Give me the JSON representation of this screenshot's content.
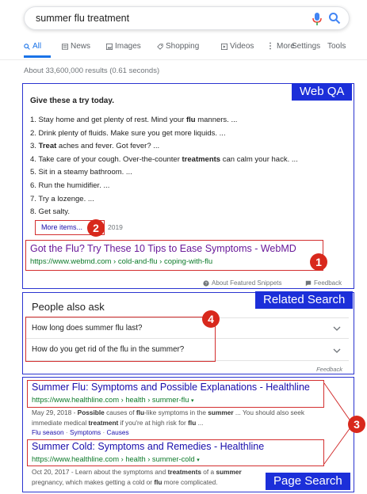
{
  "search": {
    "query": "summer flu treatment"
  },
  "tabs": [
    {
      "icon": "search-icon",
      "label": "All"
    },
    {
      "icon": "news-icon",
      "label": "News"
    },
    {
      "icon": "images-icon",
      "label": "Images"
    },
    {
      "icon": "shopping-icon",
      "label": "Shopping"
    },
    {
      "icon": "videos-icon",
      "label": "Videos"
    },
    {
      "icon": "more-icon",
      "label": "More"
    }
  ],
  "tools": {
    "settings": "Settings",
    "tools": "Tools"
  },
  "result_stats": "About 33,600,000 results (0.61 seconds)",
  "snippet": {
    "heading": "Give these a try today.",
    "items": [
      [
        "1. Stay home and get plenty of rest. Mind your ",
        "flu",
        " manners. ..."
      ],
      [
        "2. Drink plenty of fluids. Make sure you get more liquids. ...",
        "",
        ""
      ],
      [
        "3. ",
        "Treat",
        " aches and fever. Got fever? ..."
      ],
      [
        "4. Take care of your cough. Over-the-counter ",
        "treatments",
        " can calm your hack. ..."
      ],
      [
        "5. Sit in a steamy bathroom. ...",
        "",
        ""
      ],
      [
        "6. Run the humidifier. ...",
        "",
        ""
      ],
      [
        "7. Try a lozenge. ...",
        "",
        ""
      ],
      [
        "8. Get salty.",
        "",
        ""
      ]
    ],
    "more_items": "More items...",
    "date": "2019",
    "title": "Got the Flu? Try These 10 Tips to Ease Symptoms - WebMD",
    "url": "https://www.webmd.com › cold-and-flu › coping-with-flu",
    "about_link": "About Featured Snippets",
    "feedback": "Feedback"
  },
  "people_also_ask": {
    "title": "People also ask",
    "questions": [
      "How long does summer flu last?",
      "How do you get rid of the flu in the summer?"
    ],
    "feedback": "Feedback"
  },
  "results": [
    {
      "title": "Summer Flu: Symptoms and Possible Explanations - Healthline",
      "url": "https://www.healthline.com › health › summer-flu",
      "snippet_line1": [
        "May 29, 2018 - ",
        "Possible",
        " causes of ",
        "flu",
        "-like symptoms in the ",
        "summer",
        " ... You should also seek"
      ],
      "snippet_line2": [
        "immediate medical ",
        "treatment",
        " if you're at high risk for ",
        "flu",
        " ..."
      ],
      "links": [
        "Flu season",
        "Symptoms",
        "Causes"
      ]
    },
    {
      "title": "Summer Cold: Symptoms and Remedies - Healthline",
      "url": "https://www.healthline.com › health › summer-cold",
      "snippet_line1": [
        "Oct 20, 2017 - Learn about the symptoms and ",
        "treatments",
        " of a ",
        "summer",
        "",
        "",
        ""
      ],
      "snippet_line2": [
        "pregnancy, which makes getting a cold or ",
        "flu",
        " more complicated.",
        "",
        ""
      ]
    }
  ],
  "annotations": {
    "web_qa": "Web QA",
    "related_search": "Related Search",
    "page_search": "Page Search",
    "badges": [
      "1",
      "2",
      "3",
      "4"
    ]
  },
  "colors": {
    "annotation_blue": "#2b34d0",
    "annotation_red": "#d32f2f",
    "link_blue": "#1a0dab",
    "visited_purple": "#6a1b9a",
    "url_green": "#0d7a2a"
  }
}
